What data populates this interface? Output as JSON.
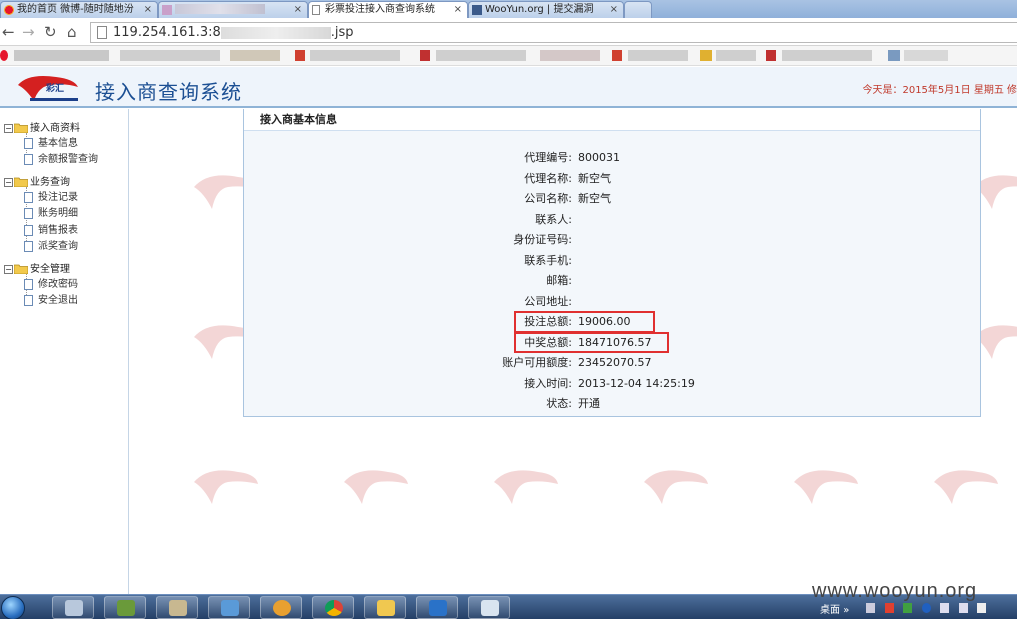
{
  "browser": {
    "tabs": [
      {
        "label": "我的首页 微博-随时随地汾",
        "icon": "weibo-icon",
        "active": false
      },
      {
        "label": "",
        "icon": "blurred-icon",
        "active": false
      },
      {
        "label": "彩票投注接入商查询系统",
        "icon": "page-icon",
        "active": true
      },
      {
        "label": "WooYun.org | 提交漏洞",
        "icon": "wooyun-icon",
        "active": false
      }
    ],
    "url_prefix": "119.254.161.3:8",
    "url_suffix": ".jsp"
  },
  "header": {
    "logo_text": "彩汇",
    "title": "接入商查询系统",
    "today": "今天是：2015年5月1日  星期五  修"
  },
  "tree": {
    "groups": [
      {
        "label": "接入商资料",
        "items": [
          "基本信息",
          "余额报警查询"
        ]
      },
      {
        "label": "业务查询",
        "items": [
          "投注记录",
          "账务明细",
          "销售报表",
          "派奖查询"
        ]
      },
      {
        "label": "安全管理",
        "items": [
          "修改密码",
          "安全退出"
        ]
      }
    ]
  },
  "panel": {
    "title": "接入商基本信息",
    "fields": [
      {
        "label": "代理编号:",
        "value": "800031"
      },
      {
        "label": "代理名称:",
        "value": "新空气"
      },
      {
        "label": "公司名称:",
        "value": "新空气"
      },
      {
        "label": "联系人:",
        "value": ""
      },
      {
        "label": "身份证号码:",
        "value": ""
      },
      {
        "label": "联系手机:",
        "value": ""
      },
      {
        "label": "邮箱:",
        "value": ""
      },
      {
        "label": "公司地址:",
        "value": ""
      },
      {
        "label": "投注总额:",
        "value": "19006.00"
      },
      {
        "label": "中奖总额:",
        "value": "18471076.57"
      },
      {
        "label": "账户可用额度:",
        "value": "23452070.57"
      },
      {
        "label": "接入时间:",
        "value": "2013-12-04 14:25:19"
      },
      {
        "label": "状态:",
        "value": "开通"
      }
    ]
  },
  "taskbar": {
    "tray_label": "桌面",
    "tray_arrows": "»"
  },
  "watermark": "www.wooyun.org",
  "colors": {
    "accent": "#1c4f93",
    "highlight": "#e03030",
    "date": "#c0392b"
  }
}
